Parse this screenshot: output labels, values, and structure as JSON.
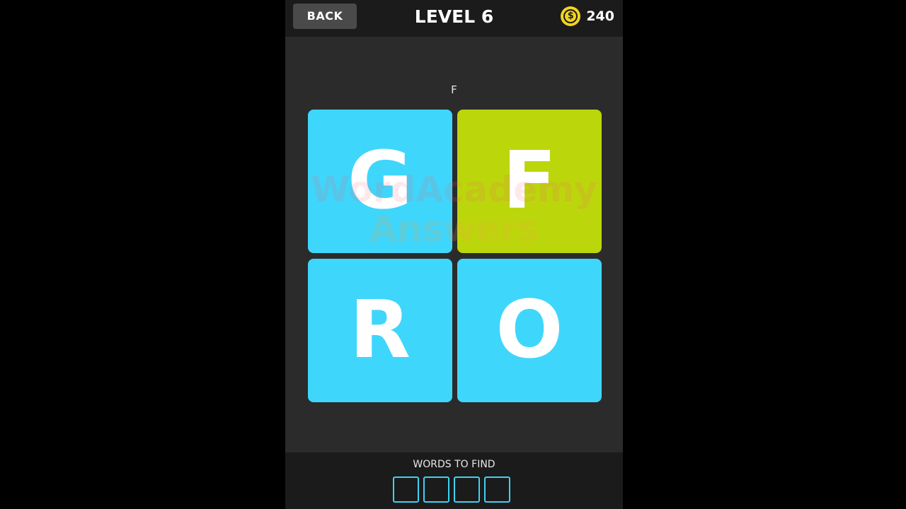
{
  "header": {
    "back_label": "BACK",
    "level_title": "LEVEL 6",
    "coin_symbol": "$",
    "coin_count": "240"
  },
  "answer": {
    "current": "F"
  },
  "tiles": [
    {
      "letter": "G",
      "color": "#3fd6fb"
    },
    {
      "letter": "F",
      "color": "#bcd60c"
    },
    {
      "letter": "R",
      "color": "#3fd6fb"
    },
    {
      "letter": "O",
      "color": "#3fd6fb"
    }
  ],
  "watermark": {
    "line1": "WordAcademy",
    "line2": "Answers"
  },
  "footer": {
    "words_label": "WORDS TO FIND",
    "slot_count": 4,
    "slot_color": "#3fd1f4"
  },
  "colors": {
    "background": "#2b2b2b",
    "bar": "#1b1b1b",
    "coin": "#f3d41e"
  }
}
